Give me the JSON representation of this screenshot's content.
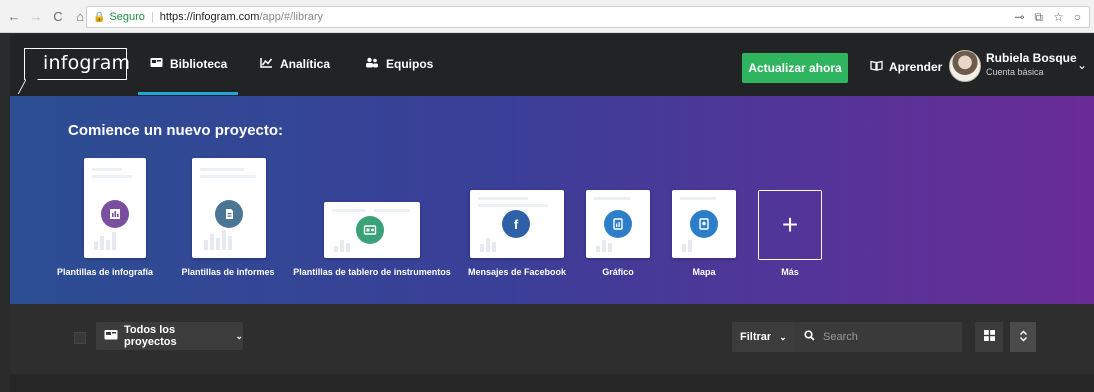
{
  "browser": {
    "back": "←",
    "forward": "→",
    "reload": "C",
    "home": "⌂",
    "secure_label": "Seguro",
    "url_host": "https://infogram.com",
    "url_path": "/app/#/library"
  },
  "header": {
    "logo": "infogram",
    "tabs": [
      {
        "label": "Biblioteca",
        "icon": "library-icon"
      },
      {
        "label": "Analítica",
        "icon": "analytics-icon"
      },
      {
        "label": "Equipos",
        "icon": "teams-icon"
      }
    ],
    "upgrade_label": "Actualizar ahora",
    "learn_label": "Aprender",
    "user_name": "Rubiela Bosque",
    "user_plan": "Cuenta básica"
  },
  "hero": {
    "title": "Comience un nuevo proyecto:",
    "templates": [
      {
        "label": "Plantillas de infografía",
        "icon": "infographic-icon",
        "color": "#7a4fa0"
      },
      {
        "label": "Plantillas de informes",
        "icon": "report-icon",
        "color": "#4c7593"
      },
      {
        "label": "Plantillas de tablero de instrumentos",
        "icon": "dashboard-icon",
        "color": "#3aa179"
      },
      {
        "label": "Mensajes de Facebook",
        "icon": "facebook-icon",
        "color": "#2f61a8"
      },
      {
        "label": "Gráfico",
        "icon": "chart-icon",
        "color": "#2d7ec9"
      },
      {
        "label": "Mapa",
        "icon": "map-icon",
        "color": "#2d7ec9"
      },
      {
        "label": "Más",
        "icon": "plus-icon"
      }
    ]
  },
  "toolbar": {
    "projects_label": "Todos los proyectos",
    "filter_label": "Filtrar",
    "search_placeholder": "Search"
  }
}
